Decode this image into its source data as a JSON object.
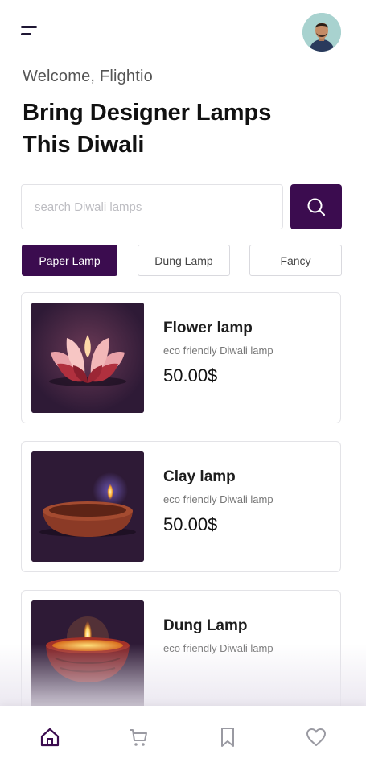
{
  "header": {
    "welcome": "Welcome, Flightio",
    "headline_line1": "Bring Designer Lamps",
    "headline_line2": "This Diwali"
  },
  "search": {
    "placeholder": "search Diwali lamps",
    "value": ""
  },
  "categories": [
    {
      "label": "Paper Lamp",
      "active": true
    },
    {
      "label": "Dung Lamp",
      "active": false
    },
    {
      "label": "Fancy",
      "active": false
    }
  ],
  "products": [
    {
      "title": "Flower lamp",
      "subtitle": "eco friendly Diwali lamp",
      "price": "50.00$"
    },
    {
      "title": "Clay lamp",
      "subtitle": "eco friendly Diwali lamp",
      "price": "50.00$"
    },
    {
      "title": "Dung Lamp",
      "subtitle": "eco friendly Diwali lamp",
      "price": ""
    }
  ],
  "nav": {
    "items": [
      "home-icon",
      "cart-icon",
      "bookmark-icon",
      "heart-icon"
    ],
    "active": "home-icon"
  },
  "colors": {
    "accent": "#3b0c4f",
    "thumb_bg": "#2e1a36"
  }
}
